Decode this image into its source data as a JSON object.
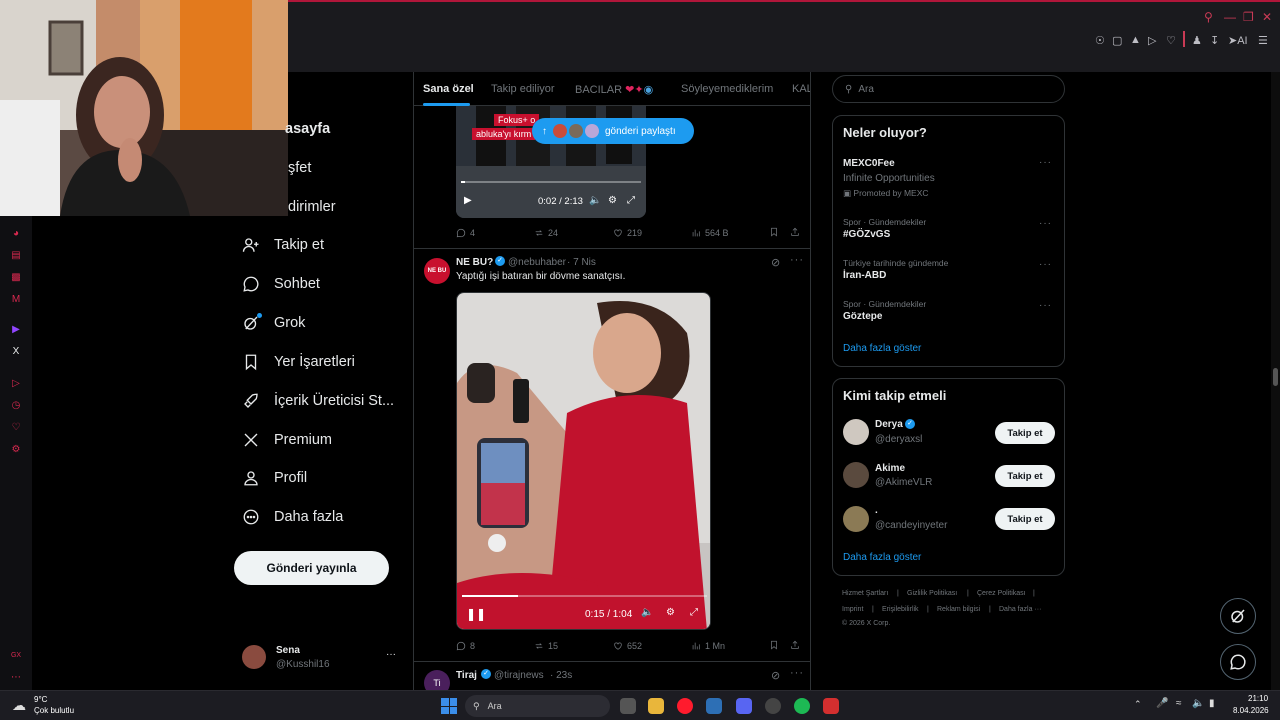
{
  "browser": {
    "toolbar_icons": [
      "pin-icon",
      "screenshot-icon",
      "shield-icon",
      "play-icon",
      "heart-icon",
      "account-icon",
      "download-icon",
      "ai-icon",
      "menu-icon"
    ],
    "ai_label": "AI"
  },
  "nav": {
    "items": [
      {
        "label": "Anasayfa",
        "icon": "home-icon"
      },
      {
        "label": "Keşfet",
        "icon": "search-icon"
      },
      {
        "label": "Bildirimler",
        "icon": "bell-icon"
      },
      {
        "label": "Takip et",
        "icon": "follow-icon"
      },
      {
        "label": "Sohbet",
        "icon": "chat-icon"
      },
      {
        "label": "Grok",
        "icon": "grok-icon"
      },
      {
        "label": "Yer İşaretleri",
        "icon": "bookmark-icon"
      },
      {
        "label": "İçerik Üreticisi St...",
        "icon": "rocket-icon"
      },
      {
        "label": "Premium",
        "icon": "x-logo-icon"
      },
      {
        "label": "Profil",
        "icon": "profile-icon"
      },
      {
        "label": "Daha fazla",
        "icon": "more-icon"
      }
    ],
    "visible_partial": [
      "asayfa",
      "şfet",
      "dirimler"
    ],
    "post_button": "Gönderi yayınla",
    "account": {
      "name": "Sena",
      "handle": "@Kusshil16",
      "more": "···"
    }
  },
  "tabs": [
    {
      "label": "Sana özel",
      "active": true
    },
    {
      "label": "Takip ediliyor",
      "active": false
    },
    {
      "label": "BACILAR",
      "active": false
    },
    {
      "label": "Söyleyemediklerim",
      "active": false
    },
    {
      "label": "KAL",
      "active": false
    }
  ],
  "new_posts_pill": "gönderi paylaştı",
  "post1": {
    "overlay_tags": [
      "Fokus+ o",
      "abluka'yı kırm"
    ],
    "video": {
      "time": "0:02 / 2:13",
      "progress": 0.02
    },
    "stats": {
      "replies": "4",
      "reposts": "24",
      "likes": "219",
      "views": "564 B"
    }
  },
  "post2": {
    "author": "NE BU?",
    "handle": "@nebuhaber",
    "time": "· 7 Nis",
    "avatar_text": "NE BU",
    "text": "Yaptığı işi batıran bir dövme sanatçısı.",
    "video": {
      "time": "0:15 / 1:04",
      "progress": 0.23
    },
    "stats": {
      "replies": "8",
      "reposts": "15",
      "likes": "652",
      "views": "1 Mn"
    }
  },
  "post3": {
    "author": "Tiraj",
    "handle": "@tirajnews",
    "time": "· 23s",
    "avatar_text": "Ti"
  },
  "search": {
    "placeholder": "Ara"
  },
  "trends": {
    "title": "Neler oluyor?",
    "items": [
      {
        "meta": "",
        "name": "MEXC0Fee",
        "sub": "Infinite Opportunities",
        "promo": "Promoted by MEXC"
      },
      {
        "meta": "Spor · Gündemdekiler",
        "name": "#GÖZvGS"
      },
      {
        "meta": "Türkiye tarihinde gündemde",
        "name": "İran-ABD"
      },
      {
        "meta": "Spor · Gündemdekiler",
        "name": "Göztepe"
      }
    ],
    "show_more": "Daha fazla göster"
  },
  "who_to_follow": {
    "title": "Kimi takip etmeli",
    "users": [
      {
        "name": "Derya",
        "handle": "@deryaxsl",
        "verified": true,
        "button": "Takip et"
      },
      {
        "name": "Akime",
        "handle": "@AkimeVLR",
        "verified": false,
        "button": "Takip et"
      },
      {
        "name": ".",
        "handle": "@candeyinyeter",
        "verified": false,
        "button": "Takip et"
      }
    ],
    "show_more": "Daha fazla göster"
  },
  "footer": {
    "links": [
      "Hizmet Şartları",
      "Gizlilik Politikası",
      "Çerez Politikası",
      "Imprint",
      "Erişilebilirlik",
      "Reklam bilgisi",
      "Daha fazla ···"
    ],
    "sep": "|",
    "copyright": "© 2026 X Corp."
  },
  "taskbar": {
    "weather_temp": "9°C",
    "weather_desc": "Çok bulutlu",
    "search_label": "Ara",
    "time": "21:10",
    "date": "8.04.2026",
    "colors": {
      "windows": "#3b8eea",
      "spotify": "#1db954",
      "discord": "#5865f2",
      "opera": "#ff1b2d"
    }
  },
  "colors": {
    "accent": "#1d9bf0",
    "brand_red": "#d8294f"
  }
}
